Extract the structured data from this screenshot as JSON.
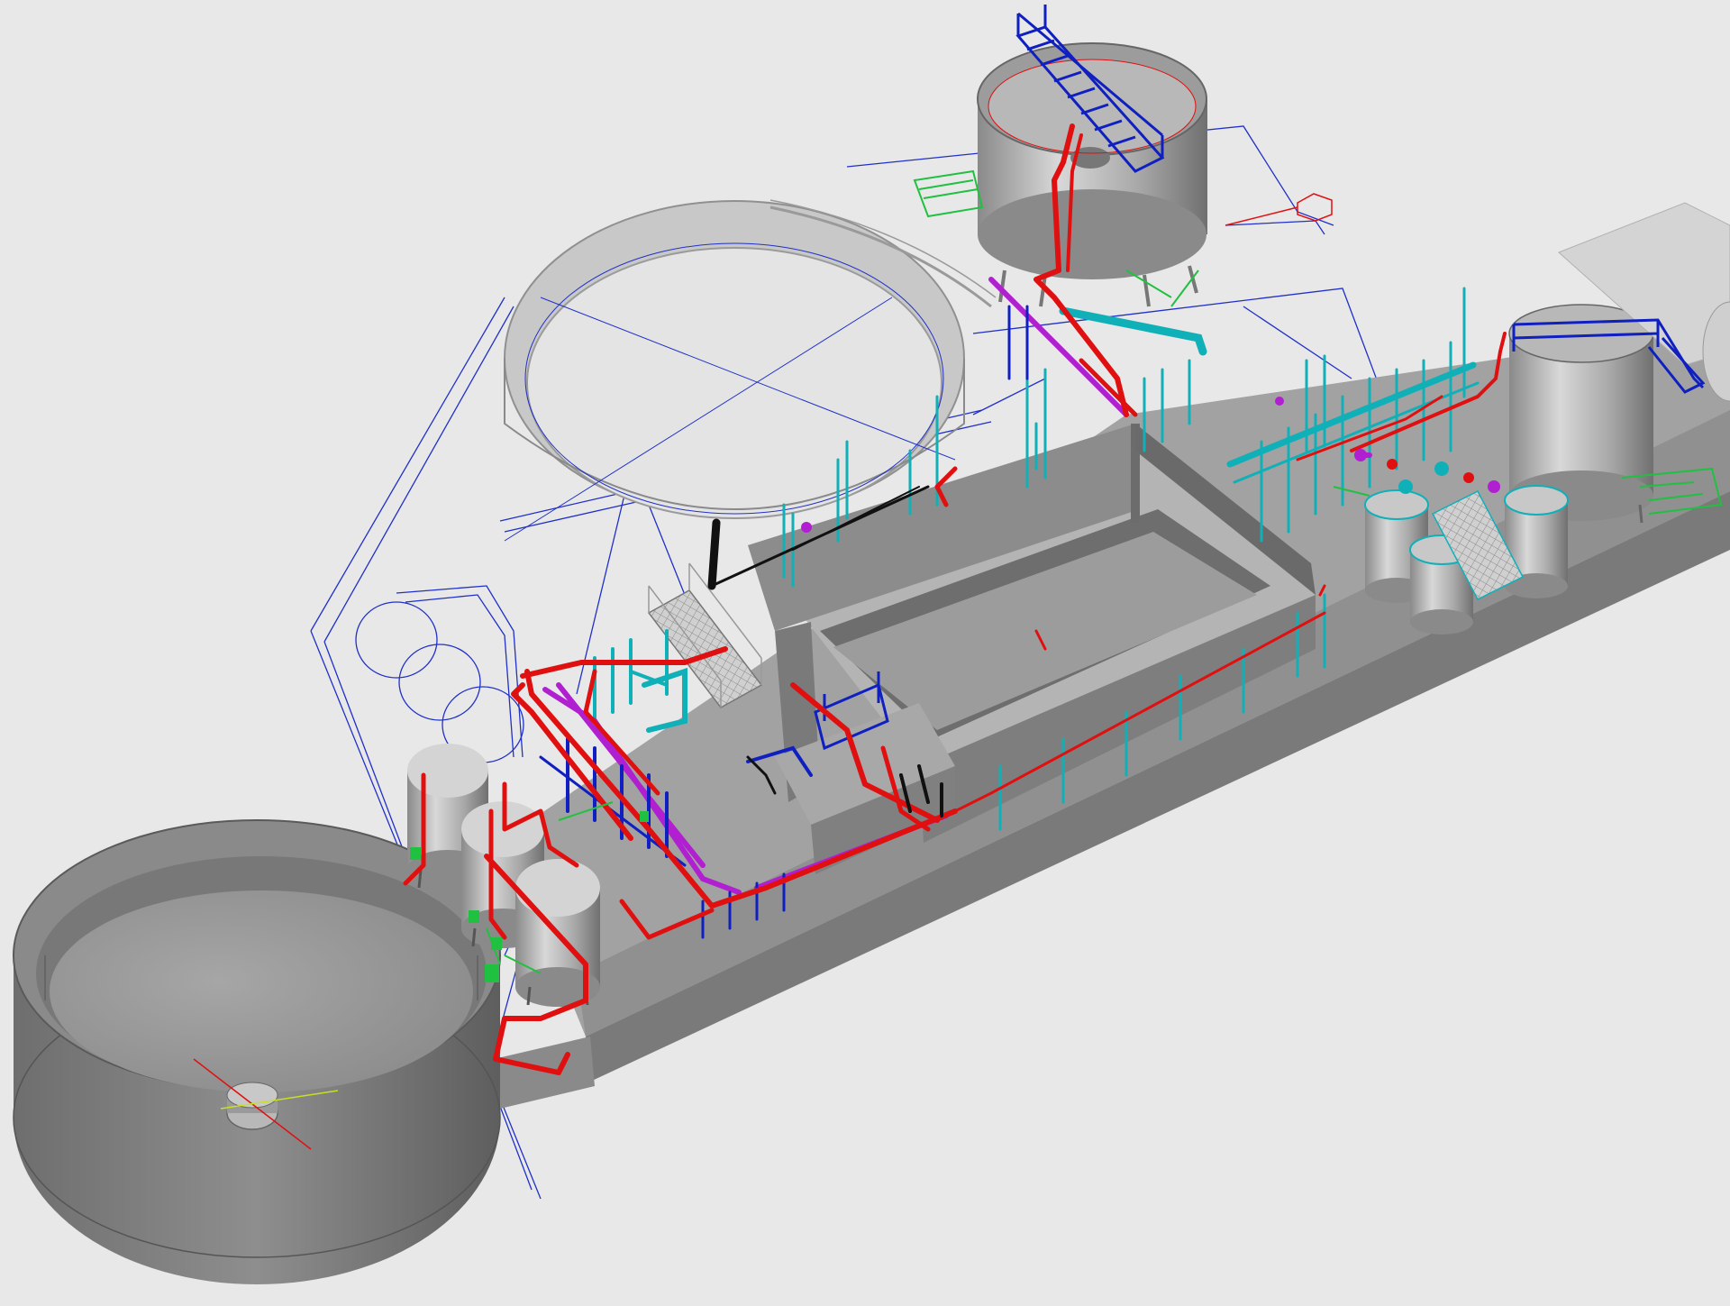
{
  "scene": {
    "background": "#e8e8e8",
    "colors": {
      "concrete_top": "#9a9a9a",
      "concrete_side": "#7c7c7c",
      "concrete_dark": "#6a6a6a",
      "tank_light": "#c4c4c4",
      "pipe_red": "#e01010",
      "pipe_magenta": "#b020d0",
      "pipe_cyan": "#10b0b8",
      "pipe_blue": "#1020c0",
      "pipe_black": "#111111",
      "outline_blue": "#2030c8",
      "green": "#20c040",
      "grating": "#b8b8b8"
    },
    "icons": [
      "clarifier-tank",
      "thickener-tank",
      "pressure-filter-vessel",
      "dosing-tank",
      "pipe-rack",
      "walkway-grating",
      "stair"
    ]
  }
}
